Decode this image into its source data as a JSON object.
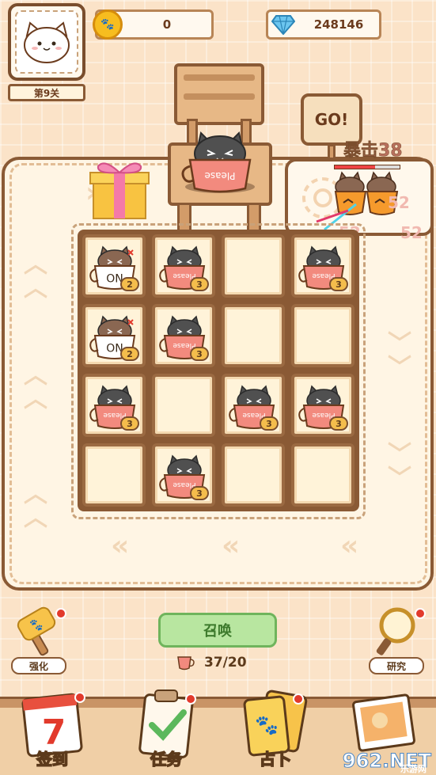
{
  "header": {
    "level_label": "第9关",
    "coins": "0",
    "gems": "248146"
  },
  "battle": {
    "go_label": "GO!",
    "crit_label": "暴击38",
    "damage_numbers": [
      "52",
      "52",
      "52"
    ]
  },
  "board": {
    "cells": [
      {
        "cup": "NO",
        "color": "#fff",
        "cat": "#8a6752",
        "level": "2"
      },
      {
        "cup": "Please",
        "color": "#f28a7e",
        "cat": "#505050",
        "level": "3"
      },
      {
        "cup": "",
        "color": "",
        "cat": "",
        "level": ""
      },
      {
        "cup": "Please",
        "color": "#f28a7e",
        "cat": "#505050",
        "level": "3"
      },
      {
        "cup": "NO",
        "color": "#fff",
        "cat": "#8a6752",
        "level": "2"
      },
      {
        "cup": "Please",
        "color": "#f28a7e",
        "cat": "#505050",
        "level": "3"
      },
      {
        "cup": "",
        "color": "",
        "cat": "",
        "level": ""
      },
      {
        "cup": "",
        "color": "",
        "cat": "",
        "level": ""
      },
      {
        "cup": "Please",
        "color": "#f28a7e",
        "cat": "#505050",
        "level": "3"
      },
      {
        "cup": "",
        "color": "",
        "cat": "",
        "level": ""
      },
      {
        "cup": "Please",
        "color": "#f28a7e",
        "cat": "#505050",
        "level": "3"
      },
      {
        "cup": "Please",
        "color": "#f28a7e",
        "cat": "#505050",
        "level": "3"
      },
      {
        "cup": "",
        "color": "",
        "cat": "",
        "level": ""
      },
      {
        "cup": "Please",
        "color": "#f28a7e",
        "cat": "#505050",
        "level": "3"
      },
      {
        "cup": "",
        "color": "",
        "cat": "",
        "level": ""
      },
      {
        "cup": "",
        "color": "",
        "cat": "",
        "level": ""
      }
    ]
  },
  "controls": {
    "summon_label": "召唤",
    "cup_count": "37/20",
    "upgrade_label": "强化",
    "research_label": "研究"
  },
  "nav": {
    "checkin_label": "签到",
    "checkin_day": "7",
    "tasks_label": "任务",
    "fortune_label": "占卜"
  },
  "watermark": {
    "brand": "962.NET",
    "sub": "乐游网"
  },
  "colors": {
    "background": "#fbe3c8",
    "wood": "#8a5a35",
    "summon_green": "#b8e6a0",
    "accent_red": "#e23a2c"
  }
}
